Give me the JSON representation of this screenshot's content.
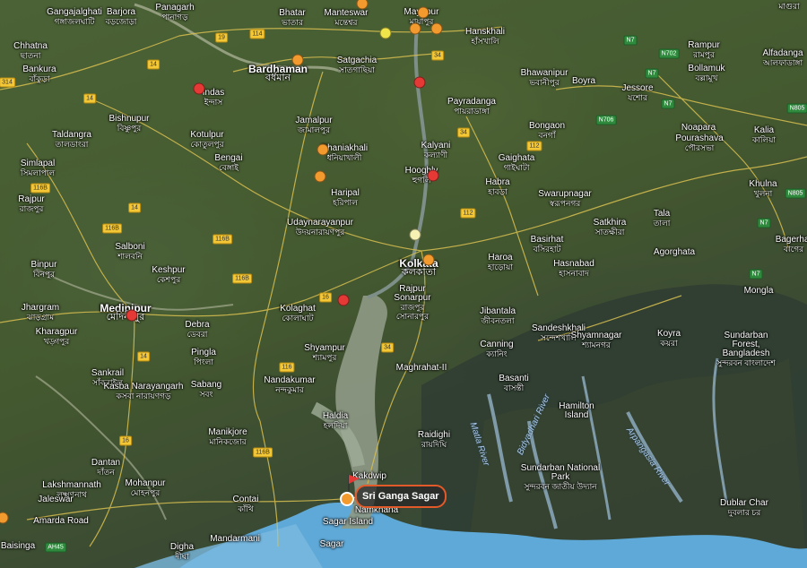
{
  "colors": {
    "pin_red": "#e53935",
    "pin_orange": "#f29a2e",
    "pin_yellow": "#efe54a",
    "pin_light": "#f6f2b3",
    "road_yellow": "#f3c735",
    "sea": "#5fa9d8"
  },
  "places": [
    {
      "en": "Panagarh",
      "bn": "পানাগড়"
    },
    {
      "en": "Bhatar",
      "bn": "ভাতার"
    },
    {
      "en": "Manteswar",
      "bn": "মন্তেশ্বর"
    },
    {
      "en": "Mayapur",
      "bn": "মায়াপুর"
    },
    {
      "en": "Gangajalghati",
      "bn": "গঙ্গাজলঘাটি"
    },
    {
      "en": "Barjora",
      "bn": "বড়জোড়া"
    },
    {
      "en": "Chhatna",
      "bn": "ছাতনা"
    },
    {
      "en": "Bankura",
      "bn": "বাঁকুড়া"
    },
    {
      "en": "Bardhaman",
      "bn": "বর্ধমান"
    },
    {
      "en": "Satgachia",
      "bn": "সাতগাছিয়া"
    },
    {
      "en": "Hanskhali",
      "bn": "হাঁসখালি"
    },
    {
      "en": "Bhawanipur",
      "bn": "ভবানীপুর"
    },
    {
      "en": "Indas",
      "bn": "ইন্দাস"
    },
    {
      "en": "Payradanga",
      "bn": "পায়রাডাঙ্গা"
    },
    {
      "en": "Bishnupur",
      "bn": "বিষ্ণুপুর"
    },
    {
      "en": "Jamalpur",
      "bn": "জামালপুর"
    },
    {
      "en": "Taldangra",
      "bn": "তালডাংরা"
    },
    {
      "en": "Kotulpur",
      "bn": "কোতুলপুর"
    },
    {
      "en": "Dhaniakhali",
      "bn": "ধনিয়াখালী"
    },
    {
      "en": "Kalyani",
      "bn": "কল্যাণী"
    },
    {
      "en": "Bongaon",
      "bn": "বনগাঁ"
    },
    {
      "en": "Bengai",
      "bn": "বেঙ্গাই"
    },
    {
      "en": "Gaighata",
      "bn": "গাইঘাটা"
    },
    {
      "en": "Hooghly",
      "bn": "হুগলি"
    },
    {
      "en": "Simlapal",
      "bn": "সিমলাপাল"
    },
    {
      "en": "Habra",
      "bn": "হাবড়া"
    },
    {
      "en": "Haripal",
      "bn": "হরিপাল"
    },
    {
      "en": "Swarupnagar",
      "bn": "স্বরূপনগর"
    },
    {
      "en": "Rajpur",
      "bn": "রাজপুর"
    },
    {
      "en": "Udaynarayanpur",
      "bn": "উদয়নারায়ণপুর"
    },
    {
      "en": "Salboni",
      "bn": "শালবনি"
    },
    {
      "en": "Kolkata",
      "bn": "কলকাতা"
    },
    {
      "en": "Basirhat",
      "bn": "বসিরহাট"
    },
    {
      "en": "Haroa",
      "bn": "হাড়োয়া"
    },
    {
      "en": "Keshpur",
      "bn": "কেশপুর"
    },
    {
      "en": "Binpur",
      "bn": "বিনপুর"
    },
    {
      "en": "Hasnabad",
      "bn": "হাসনাবাদ"
    },
    {
      "en": "Rajpur Sonarpur",
      "bn": "রাজপুর সোনারপুর"
    },
    {
      "en": "Kolaghat",
      "bn": "কোলাঘাট"
    },
    {
      "en": "Medinipur",
      "bn": "মেদিনীপুর"
    },
    {
      "en": "Jhargram",
      "bn": "ঝাড়গ্রাম"
    },
    {
      "en": "Debra",
      "bn": "ডেবরা"
    },
    {
      "en": "Jibantala",
      "bn": "জীবনতলা"
    },
    {
      "en": "Kharagpur",
      "bn": "খড়্গপুর"
    },
    {
      "en": "Sandeshkhali",
      "bn": "সন্দেশখালি"
    },
    {
      "en": "Shyampur",
      "bn": "শ্যামপুর"
    },
    {
      "en": "Pingla",
      "bn": "পিংলা"
    },
    {
      "en": "Canning",
      "bn": "ক্যানিং"
    },
    {
      "en": "Maghrahat-II",
      "bn": ""
    },
    {
      "en": "Sankrail",
      "bn": "সাঁকরাইল"
    },
    {
      "en": "Kasba Narayangarh",
      "bn": "কসবা নারায়ণগড়"
    },
    {
      "en": "Sabang",
      "bn": "সবং"
    },
    {
      "en": "Nandakumar",
      "bn": "নন্দকুমার"
    },
    {
      "en": "Basanti",
      "bn": "বাসন্তী"
    },
    {
      "en": "Haldia",
      "bn": "হলদিয়া"
    },
    {
      "en": "Manikjore",
      "bn": "মানিকজোর"
    },
    {
      "en": "Raidighi",
      "bn": "রায়দিঘি"
    },
    {
      "en": "Dantan",
      "bn": "দাঁতন"
    },
    {
      "en": "Lakshmannath",
      "bn": "লক্ষ্মণনাথ"
    },
    {
      "en": "Mohanpur",
      "bn": "মোহনপুর"
    },
    {
      "en": "Jaleswar",
      "bn": ""
    },
    {
      "en": "Contai",
      "bn": "কাঁথি"
    },
    {
      "en": "Namkhana",
      "bn": ""
    },
    {
      "en": "Amarda Road",
      "bn": ""
    },
    {
      "en": "Sagar Island",
      "bn": ""
    },
    {
      "en": "Baisinga",
      "bn": ""
    },
    {
      "en": "Digha",
      "bn": "দীঘা"
    },
    {
      "en": "Mandarmani",
      "bn": ""
    },
    {
      "en": "Sagar",
      "bn": ""
    },
    {
      "en": "Jessore",
      "bn": "যশোর"
    },
    {
      "en": "Boyra",
      "bn": ""
    },
    {
      "en": "Rampur",
      "bn": "রামপুর"
    },
    {
      "en": "Bollamuk",
      "bn": "বল্লামুখ"
    },
    {
      "en": "Alfadanga",
      "bn": "আলফাডাঙ্গা"
    },
    {
      "en": "Noapara",
      "bn": "নওয়াপাড়া"
    },
    {
      "en": "Pourashava",
      "bn": "পৌরসভা"
    },
    {
      "en": "Kalia",
      "bn": "কালিয়া"
    },
    {
      "en": "Khulna",
      "bn": "খুলনা"
    },
    {
      "en": "Satkhira",
      "bn": "সাতক্ষীরা"
    },
    {
      "en": "Tala",
      "bn": "তালা"
    },
    {
      "en": "Agorghata",
      "bn": ""
    },
    {
      "en": "Bagerhat",
      "bn": "বাগের"
    },
    {
      "en": "Mongla",
      "bn": ""
    },
    {
      "en": "Shyamnagar",
      "bn": "শ্যামনগর"
    },
    {
      "en": "Koyra",
      "bn": "কয়রা"
    },
    {
      "en": "Sundarban Forest, Bangladesh",
      "bn": "সুন্দরবন বাংলাদেশ"
    },
    {
      "en": "Hamilton Island",
      "bn": ""
    },
    {
      "en": "Sundarban National Park",
      "bn": "সুন্দরবন জাতীয় উদ্যান"
    },
    {
      "en": "Dublar Char",
      "bn": "দুবলার চর"
    },
    {
      "en": "Kakdwip",
      "bn": ""
    },
    {
      "en": "Magura",
      "bn": "মাগুরা"
    }
  ],
  "rivers": [
    "Matla River",
    "Bidyadhari River",
    "Arpangasia River"
  ],
  "roads": [
    "19",
    "114",
    "14",
    "314",
    "116B",
    "16",
    "116",
    "34",
    "112",
    "N7",
    "N702",
    "N706",
    "N805",
    "AH45"
  ],
  "callout": {
    "label": "Sri Ganga Sagar"
  }
}
